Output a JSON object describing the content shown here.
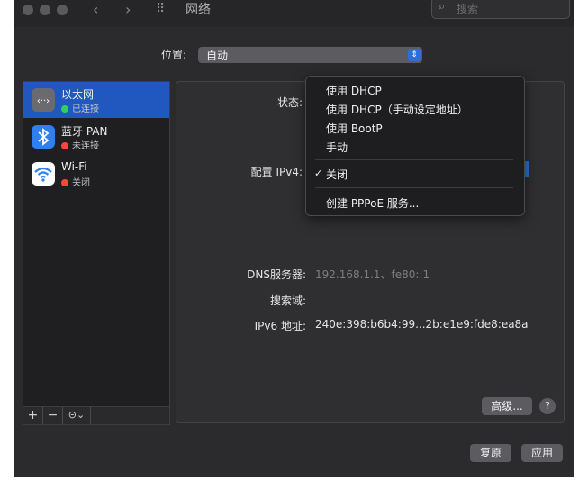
{
  "window": {
    "title": "网络",
    "search_placeholder": "搜索"
  },
  "location": {
    "label": "位置:",
    "value": "自动"
  },
  "services": [
    {
      "name": "以太网",
      "status": "已连接",
      "status_color": "#30d158",
      "icon": "ethernet-icon",
      "selected": true
    },
    {
      "name": "蓝牙 PAN",
      "status": "未连接",
      "status_color": "#ff453a",
      "icon": "bluetooth-icon",
      "selected": false
    },
    {
      "name": "Wi-Fi",
      "status": "关闭",
      "status_color": "#ff453a",
      "icon": "wifi-icon",
      "selected": false
    }
  ],
  "sidebar_controls": {
    "add": "+",
    "remove": "−",
    "action": "⊝⌄"
  },
  "detail": {
    "status_label": "状态:",
    "configure_label": "配置 IPv4:",
    "dns_label": "DNS服务器:",
    "dns_value": "192.168.1.1、fe80::1",
    "search_domain_label": "搜索域:",
    "ipv6_label": "IPv6 地址:",
    "ipv6_value": "240e:398:b6b4:99...2b:e1e9:fde8:ea8a"
  },
  "buttons": {
    "advanced": "高级...",
    "help": "?",
    "revert": "复原",
    "apply": "应用"
  },
  "ipv4_menu": {
    "items": [
      "使用 DHCP",
      "使用 DHCP（手动设定地址）",
      "使用 BootP",
      "手动"
    ],
    "selected_item": "关闭",
    "check_mark": "✓",
    "extra_item": "创建 PPPoE 服务..."
  },
  "colors": {
    "accent": "#2158bf",
    "window_bg": "#2b2b2d",
    "connected": "#30d158",
    "disconnected": "#ff453a"
  }
}
